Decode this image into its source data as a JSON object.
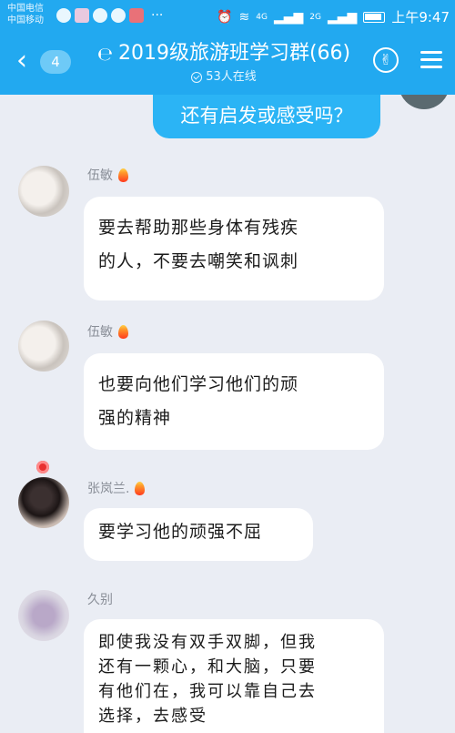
{
  "status_bar": {
    "carrier_1": "中国电信",
    "carrier_2": "中国移动",
    "more": "···",
    "signal_label": "4G",
    "signal_label_2": "2G",
    "time": "上午9:47"
  },
  "header": {
    "back_badge": "4",
    "title": "2019级旅游班学习群(66)",
    "online": "53人在线",
    "accent_color": "#22a9f0"
  },
  "chat": {
    "my_message": "还有启发或感受吗？",
    "messages": [
      {
        "sender": "伍敏",
        "text": "要去帮助那些身体有残疾\n的人，不要去嘲笑和讽刺"
      },
      {
        "sender": "伍敏",
        "text": "也要向他们学习他们的顽\n强的精神"
      },
      {
        "sender": "张岚兰.",
        "text": "要学习他的顽强不屈"
      },
      {
        "sender": "久别",
        "text": "即使我没有双手双脚，但我\n还有一颗心，和大脑，只要\n有他们在，我可以靠自己去\n选择，去感受"
      }
    ]
  }
}
